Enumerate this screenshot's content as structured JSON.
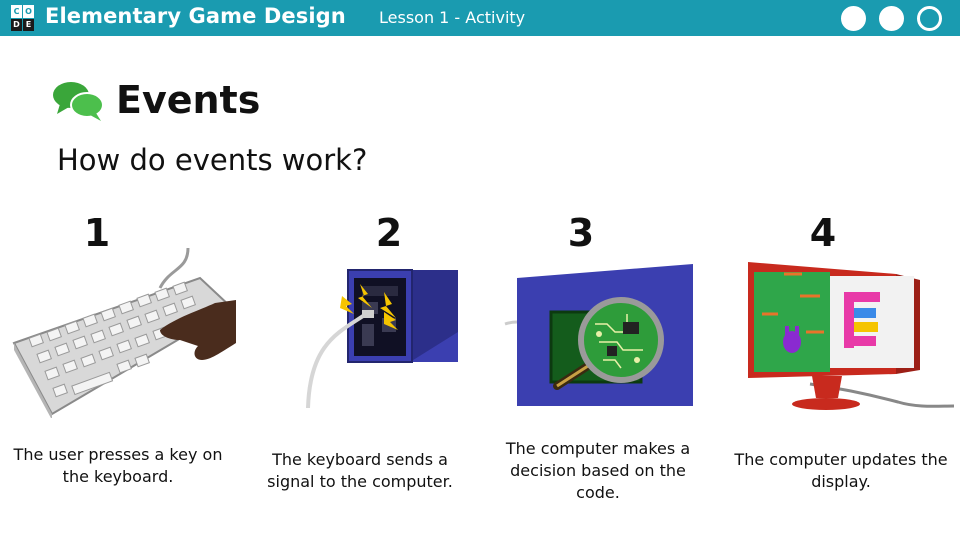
{
  "header": {
    "logo_letters": [
      "C",
      "O",
      "D",
      "E"
    ],
    "course_title": "Elementary Game Design",
    "lesson_label": "Lesson 1 - Activity",
    "progress_dots": [
      "filled",
      "filled",
      "empty"
    ]
  },
  "slide": {
    "title": "Events",
    "question": "How do events work?",
    "steps": [
      {
        "number": "1",
        "caption": "The user presses a key on the keyboard.",
        "illustration": "keyboard-hand"
      },
      {
        "number": "2",
        "caption": "The keyboard sends a signal to the computer.",
        "illustration": "computer-port-signal"
      },
      {
        "number": "3",
        "caption": "The computer makes a decision based on the code.",
        "illustration": "circuit-magnifier"
      },
      {
        "number": "4",
        "caption": "The computer updates the display.",
        "illustration": "monitor-display"
      }
    ]
  },
  "colors": {
    "header_bg": "#1a9bb0",
    "icon_green": "#3aa63a",
    "computer_blue": "#3b3fb0",
    "monitor_red": "#c82a1e"
  }
}
